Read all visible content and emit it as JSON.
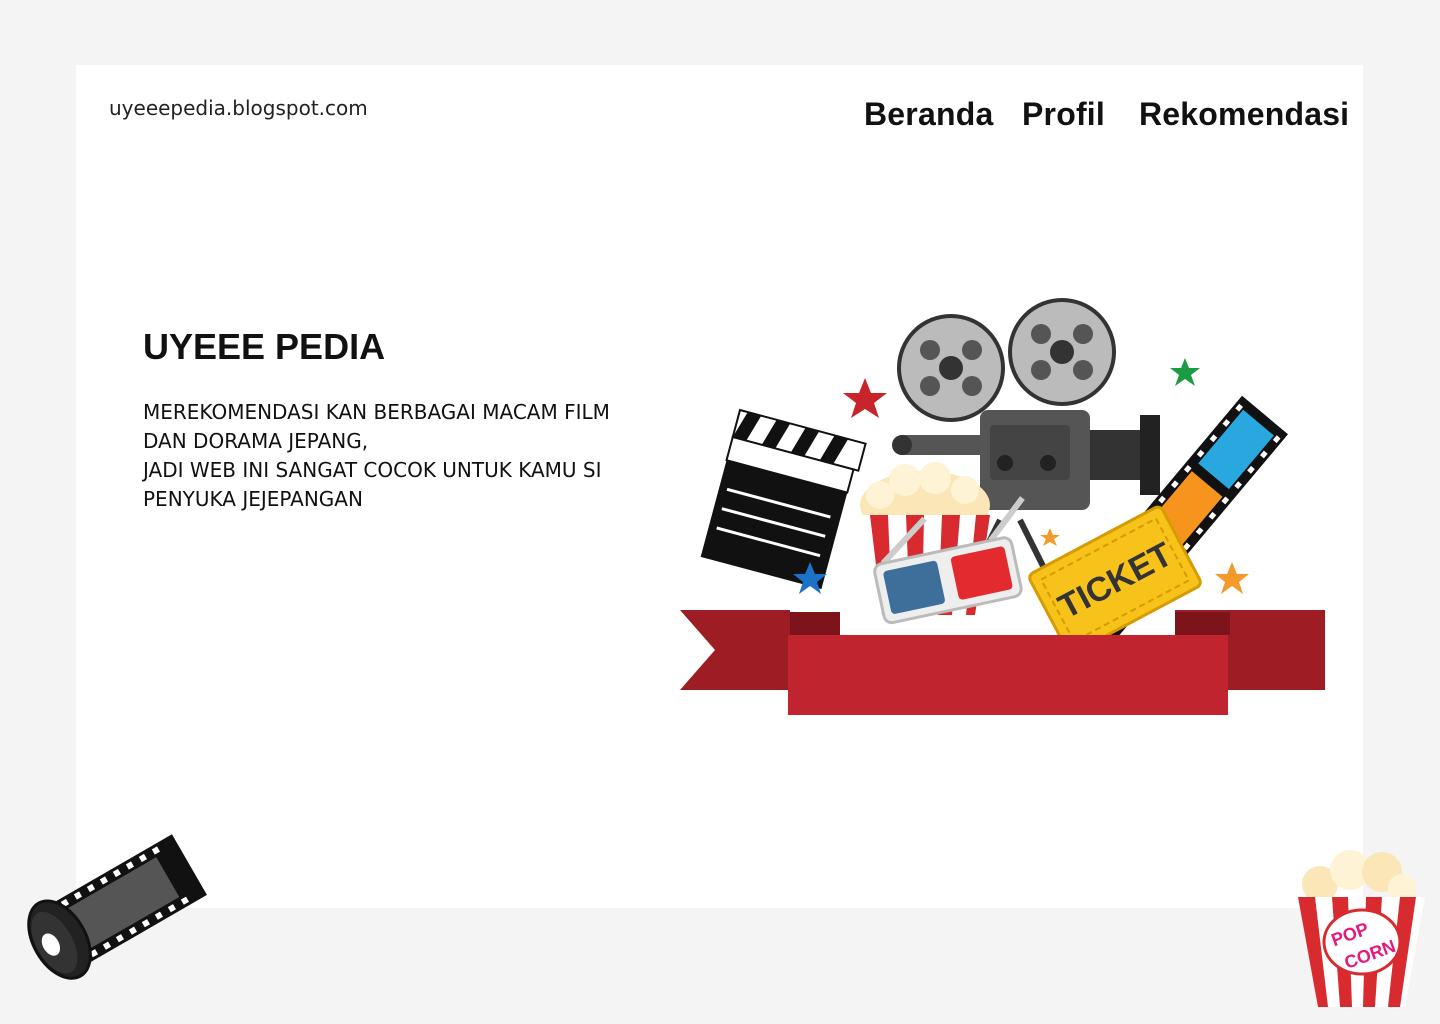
{
  "header": {
    "site_url": "uyeeepedia.blogspot.com",
    "nav": [
      {
        "label": "Beranda"
      },
      {
        "label": "Profil"
      },
      {
        "label": "Rekomendasi"
      }
    ]
  },
  "hero": {
    "title": "UYEEE PEDIA",
    "description_lines": [
      "MEREKOMENDASI KAN BERBAGAI MACAM FILM",
      "DAN DORAMA JEPANG,",
      "JADI WEB INI SANGAT COCOK UNTUK KAMU SI",
      "PENYUKA JEJEPANGAN"
    ]
  },
  "illustration": {
    "ticket_text": "TICKET",
    "popcorn_text_1": "POP",
    "popcorn_text_2": "CORN"
  },
  "colors": {
    "background": "#f4f4f4",
    "card": "#ffffff",
    "ribbon_red": "#c0252f",
    "ticket_yellow": "#f7c21a",
    "star_red": "#c8242b",
    "star_green": "#1a9b44",
    "star_blue": "#1a73c8",
    "star_orange": "#f39a2b"
  }
}
